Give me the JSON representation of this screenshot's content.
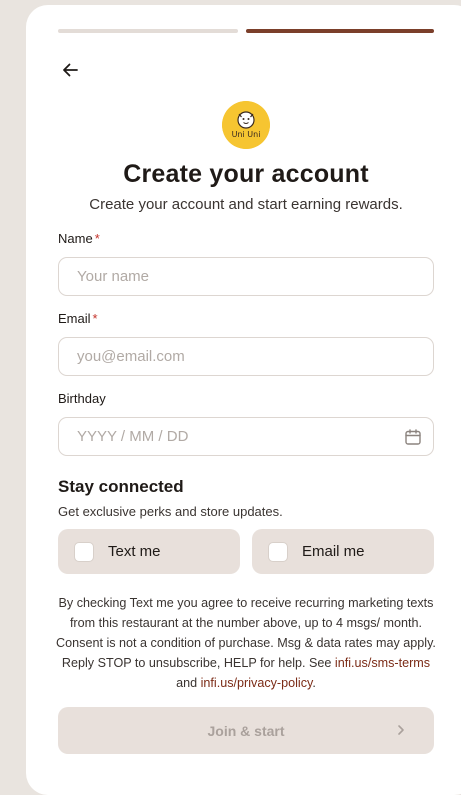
{
  "progress": {
    "step": 2,
    "total": 2
  },
  "header": {
    "title": "Create your account",
    "subtitle": "Create your account and start earning rewards.",
    "logo_text": "Uni Uni"
  },
  "form": {
    "name": {
      "label": "Name",
      "required_mark": "*",
      "placeholder": "Your name",
      "value": ""
    },
    "email": {
      "label": "Email",
      "required_mark": "*",
      "placeholder": "you@email.com",
      "value": ""
    },
    "birthday": {
      "label": "Birthday",
      "placeholder": "YYYY / MM / DD",
      "value": "",
      "icon": "calendar-icon"
    }
  },
  "stay_connected": {
    "title": "Stay connected",
    "subtitle": "Get exclusive perks and store updates.",
    "options": [
      {
        "label": "Text me",
        "checked": false
      },
      {
        "label": "Email me",
        "checked": false
      }
    ]
  },
  "legal": {
    "text_before": "By checking Text me you agree to receive recurring marketing texts from this restaurant at the number above, up to 4 msgs/ month. Consent is not a condition of purchase. Msg & data rates may apply. Reply STOP to unsubscribe, HELP for help. See ",
    "sms_terms_link": "infi.us/sms-terms",
    "and": " and ",
    "privacy_link": "infi.us/privacy-policy",
    "end": "."
  },
  "actions": {
    "join_label": "Join & start",
    "join_enabled": false
  },
  "colors": {
    "accent": "#7b3f2a",
    "link": "#7b2b16",
    "required": "#c4322a",
    "logo_bg": "#f6c531",
    "option_bg": "#e8e0db"
  }
}
